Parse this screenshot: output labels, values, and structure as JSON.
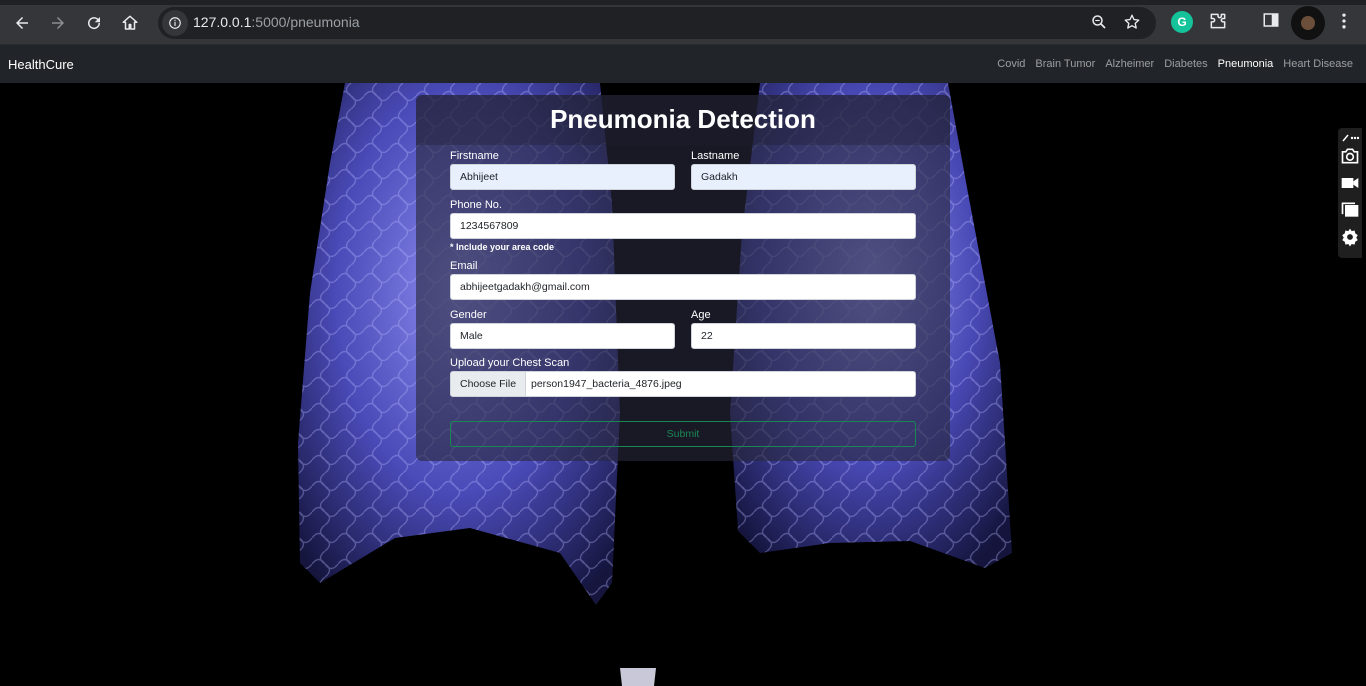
{
  "browser": {
    "url_host": "127.0.0.1",
    "url_rest": ":5000/pneumonia",
    "extension_badge": "G"
  },
  "site": {
    "brand": "HealthCure",
    "nav": [
      {
        "label": "Covid",
        "active": false
      },
      {
        "label": "Brain Tumor",
        "active": false
      },
      {
        "label": "Alzheimer",
        "active": false
      },
      {
        "label": "Diabetes",
        "active": false
      },
      {
        "label": "Pneumonia",
        "active": true
      },
      {
        "label": "Heart Disease",
        "active": false
      }
    ]
  },
  "form": {
    "title": "Pneumonia Detection",
    "firstname_label": "Firstname",
    "firstname_value": "Abhijeet",
    "lastname_label": "Lastname",
    "lastname_value": "Gadakh",
    "phone_label": "Phone No.",
    "phone_value": "1234567809",
    "phone_hint": "* Include your area code",
    "email_label": "Email",
    "email_value": "abhijeetgadakh@gmail.com",
    "gender_label": "Gender",
    "gender_value": "Male",
    "age_label": "Age",
    "age_value": "22",
    "upload_label": "Upload your Chest Scan",
    "choose_file_label": "Choose File",
    "file_name": "person1947_bacteria_4876.jpeg",
    "submit_label": "Submit"
  },
  "colors": {
    "navbar": "#212529",
    "submit_outline": "#198754",
    "scan_tint": "#6e6ee0"
  }
}
